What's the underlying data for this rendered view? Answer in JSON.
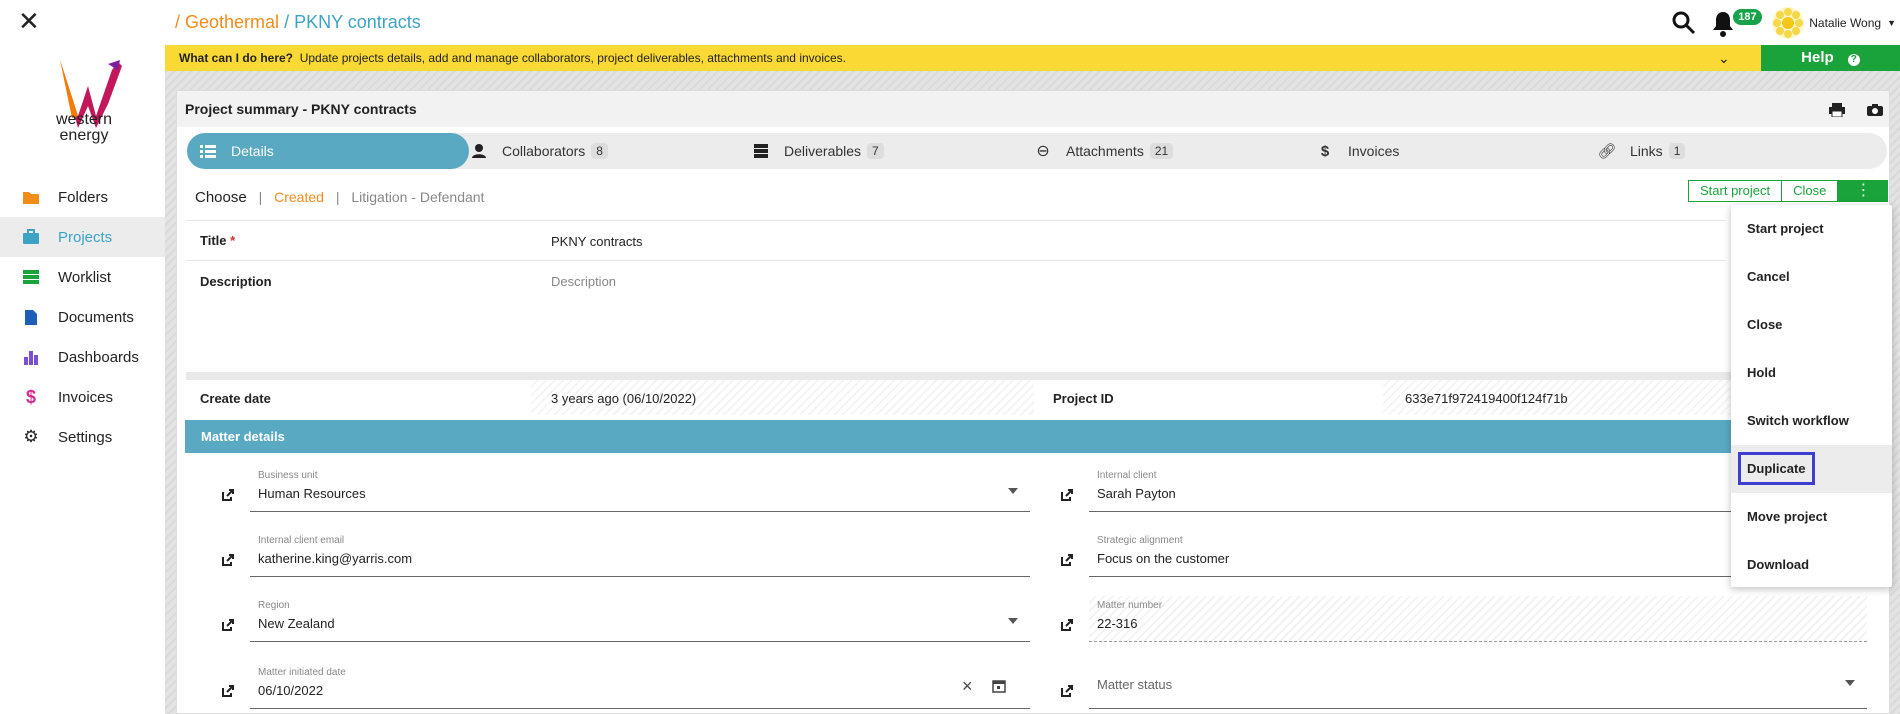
{
  "sidebar": {
    "logo_text_1": "western",
    "logo_text_2": "energy",
    "items": [
      {
        "label": "Folders",
        "icon": "folder-icon",
        "color": "#f28c1b"
      },
      {
        "label": "Projects",
        "icon": "briefcase-icon",
        "color": "#3da3c4"
      },
      {
        "label": "Worklist",
        "icon": "list-icon",
        "color": "#1aa33a"
      },
      {
        "label": "Documents",
        "icon": "document-icon",
        "color": "#1d5fb8"
      },
      {
        "label": "Dashboards",
        "icon": "bar-chart-icon",
        "color": "#7a4fd0"
      },
      {
        "label": "Invoices",
        "icon": "dollar-icon",
        "color": "#d62a8e"
      },
      {
        "label": "Settings",
        "icon": "gear-icon",
        "color": "#222222"
      }
    ]
  },
  "breadcrumb": {
    "parent": "/ Geothermal",
    "current": "/ PKNY contracts"
  },
  "user": {
    "name": "Natalie Wong",
    "notifications": "187"
  },
  "infobar": {
    "bold": "What can I do here?",
    "text": "Update projects details, add and manage collaborators, project deliverables, attachments and invoices."
  },
  "help_label": "Help",
  "panel": {
    "title": "Project summary - PKNY contracts"
  },
  "tabs": [
    {
      "label": "Details",
      "count": ""
    },
    {
      "label": "Collaborators",
      "count": "8"
    },
    {
      "label": "Deliverables",
      "count": "7"
    },
    {
      "label": "Attachments",
      "count": "21"
    },
    {
      "label": "Invoices",
      "count": ""
    },
    {
      "label": "Links",
      "count": "1"
    }
  ],
  "status": {
    "choose": "Choose",
    "created": "Created",
    "litigation": "Litigation - Defendant"
  },
  "actions": {
    "start": "Start project",
    "close": "Close",
    "more": "⋮"
  },
  "details": {
    "title_label": "Title",
    "title_value": "PKNY contracts",
    "description_label": "Description",
    "description_placeholder": "Description",
    "create_date_label": "Create date",
    "create_date_value": "3 years ago (06/10/2022)",
    "project_id_label": "Project ID",
    "project_id_value": "633e71f972419400f124f71b"
  },
  "matter": {
    "header": "Matter details",
    "business_unit_label": "Business unit",
    "business_unit_value": "Human Resources",
    "internal_client_label": "Internal client",
    "internal_client_value": "Sarah Payton",
    "client_email_label": "Internal client email",
    "client_email_value": "katherine.king@yarris.com",
    "strategic_label": "Strategic alignment",
    "strategic_value": "Focus on the customer",
    "region_label": "Region",
    "region_value": "New Zealand",
    "matter_number_label": "Matter number",
    "matter_number_value": "22-316",
    "initiated_label": "Matter initiated date",
    "initiated_value": "06/10/2022",
    "status_placeholder": "Matter status"
  },
  "menu": [
    "Start project",
    "Cancel",
    "Close",
    "Hold",
    "Switch workflow",
    "Duplicate",
    "Move project",
    "Download"
  ]
}
